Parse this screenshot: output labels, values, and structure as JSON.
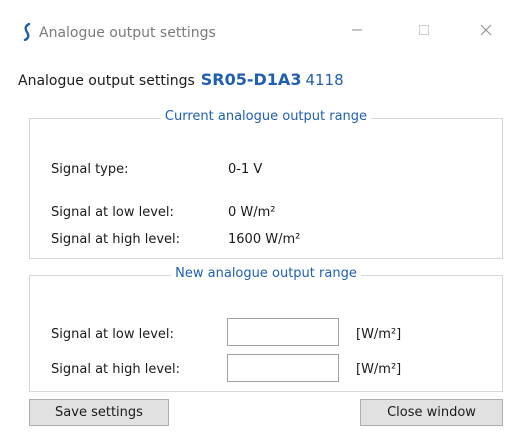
{
  "window": {
    "title": "Analogue output settings",
    "icon": "app-logo-icon",
    "controls": {
      "minimize": "minimize-icon",
      "maximize": "maximize-icon",
      "close": "close-icon"
    }
  },
  "header": {
    "label": "Analogue output settings",
    "model": "SR05-D1A3",
    "serial": "4118"
  },
  "current_range": {
    "legend": "Current analogue output range",
    "signal_type_label": "Signal type:",
    "signal_type_value": "0-1 V",
    "low_label": "Signal at low level:",
    "low_value": "0 W/m²",
    "high_label": "Signal at high level:",
    "high_value": "1600 W/m²"
  },
  "new_range": {
    "legend": "New analogue output range",
    "low_label": "Signal at low level:",
    "low_value": "",
    "low_unit": "[W/m²]",
    "high_label": "Signal at high level:",
    "high_value": "",
    "high_unit": "[W/m²]"
  },
  "buttons": {
    "save": "Save settings",
    "close": "Close window"
  },
  "colors": {
    "accent": "#1f5fb3",
    "title_text": "#7a7a7a",
    "button_bg": "#e1e1e1"
  }
}
